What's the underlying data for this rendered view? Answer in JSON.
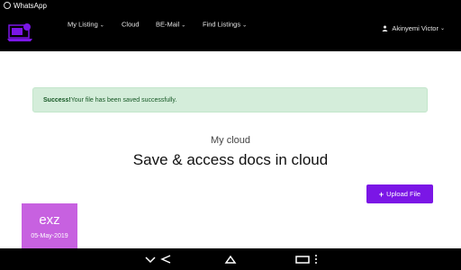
{
  "statusbar": {
    "app_label": "WhatsApp",
    "icon": "whatsapp-icon"
  },
  "nav": {
    "logo_icon": "cloud-laptop-logo",
    "items": [
      {
        "label": "My Listing",
        "dropdown": true
      },
      {
        "label": "Cloud",
        "dropdown": false
      },
      {
        "label": "BE-Mail",
        "dropdown": true
      },
      {
        "label": "Find Listings",
        "dropdown": true
      }
    ],
    "chevron": "⌄",
    "user_name": "Akinyemi Victor"
  },
  "alert": {
    "strong": "Success!",
    "message": "Your file has been saved successfully."
  },
  "page": {
    "subtitle": "My cloud",
    "title": "Save & access docs in cloud"
  },
  "upload_button": {
    "label": "Upload File",
    "icon": "plus-icon"
  },
  "files": [
    {
      "ext": "exz",
      "date": "05-May-2019"
    }
  ],
  "colors": {
    "navbar": "#000000",
    "accent": "#7b16e6",
    "card": "#c761e0",
    "alert_bg": "#d4edda",
    "alert_text": "#155724"
  },
  "android_nav": {
    "icons": [
      "caret-down-icon",
      "back-icon",
      "home-icon",
      "recents-icon",
      "menu-icon"
    ]
  }
}
